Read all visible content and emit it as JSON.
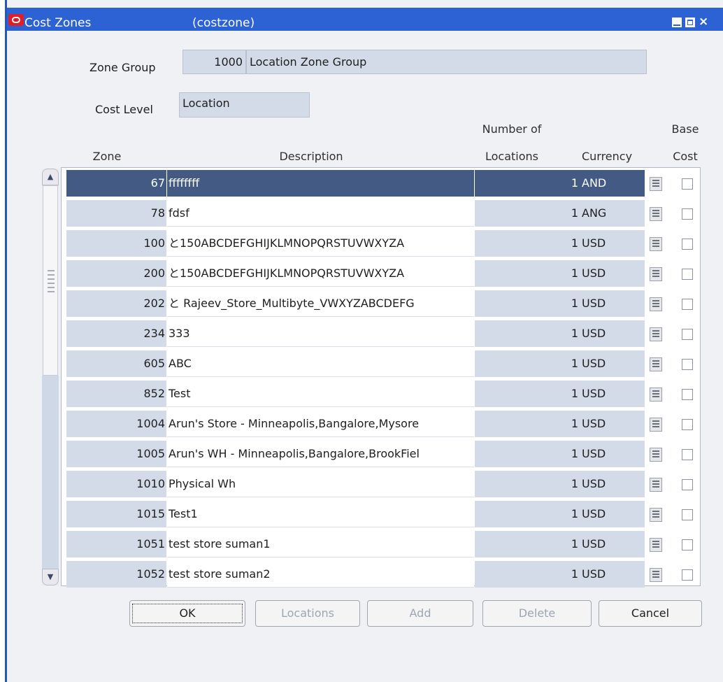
{
  "window": {
    "title": "Cost Zones",
    "subtitle": "(costzone)"
  },
  "form": {
    "zone_group_label": "Zone Group",
    "zone_group_value": "1000",
    "zone_group_desc": "Location Zone Group",
    "cost_level_label": "Cost Level",
    "cost_level_value": "Location"
  },
  "table": {
    "headers": {
      "zone": "Zone",
      "description": "Description",
      "num_locations_1": "Number of",
      "num_locations_2": "Locations",
      "currency": "Currency",
      "base_cost_1": "Base",
      "base_cost_2": "Cost"
    },
    "rows": [
      {
        "zone": "67",
        "description": "ffffffff",
        "num": "1",
        "currency": "AND",
        "selected": true
      },
      {
        "zone": "78",
        "description": "fdsf",
        "num": "1",
        "currency": "ANG"
      },
      {
        "zone": "100",
        "description": "と150ABCDEFGHIJKLMNOPQRSTUVWXYZA",
        "num": "1",
        "currency": "USD"
      },
      {
        "zone": "200",
        "description": "と150ABCDEFGHIJKLMNOPQRSTUVWXYZA",
        "num": "1",
        "currency": "USD"
      },
      {
        "zone": "202",
        "description": "と Rajeev_Store_Multibyte_VWXYZABCDEFG",
        "num": "1",
        "currency": "USD"
      },
      {
        "zone": "234",
        "description": "333",
        "num": "1",
        "currency": "USD"
      },
      {
        "zone": "605",
        "description": "ABC",
        "num": "1",
        "currency": "USD"
      },
      {
        "zone": "852",
        "description": "Test",
        "num": "1",
        "currency": "USD"
      },
      {
        "zone": "1004",
        "description": "Arun's Store - Minneapolis,Bangalore,Mysore",
        "num": "1",
        "currency": "USD"
      },
      {
        "zone": "1005",
        "description": "Arun's WH - Minneapolis,Bangalore,BrookFiel",
        "num": "1",
        "currency": "USD"
      },
      {
        "zone": "1010",
        "description": "Physical Wh",
        "num": "1",
        "currency": "USD"
      },
      {
        "zone": "1015",
        "description": "Test1",
        "num": "1",
        "currency": "USD"
      },
      {
        "zone": "1051",
        "description": "test store suman1",
        "num": "1",
        "currency": "USD"
      },
      {
        "zone": "1052",
        "description": "test store suman2",
        "num": "1",
        "currency": "USD"
      }
    ]
  },
  "buttons": {
    "ok": "OK",
    "locations": "Locations",
    "add": "Add",
    "delete": "Delete",
    "cancel": "Cancel"
  }
}
